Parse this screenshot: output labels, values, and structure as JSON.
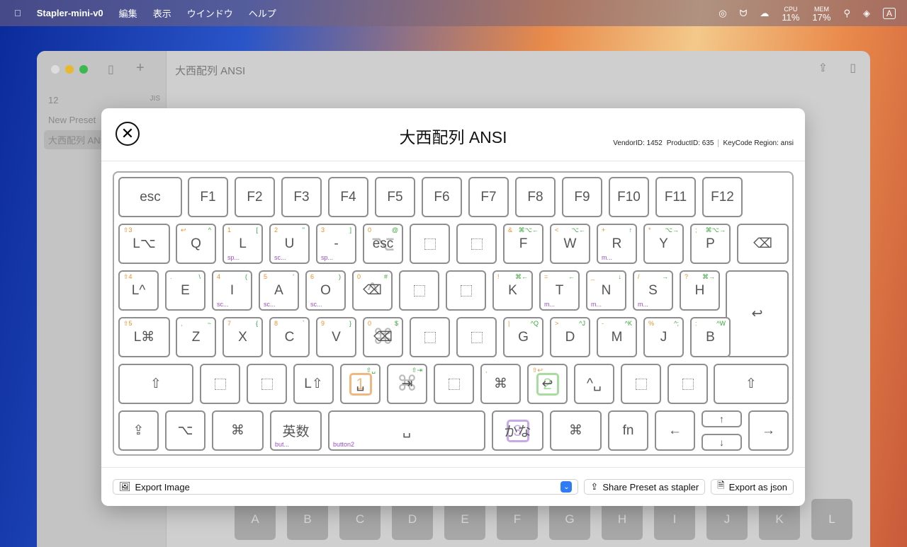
{
  "menubar": {
    "app": "Stapler-mini-v0",
    "menus": [
      "編集",
      "表示",
      "ウインドウ",
      "ヘルプ"
    ],
    "cpu_label": "CPU",
    "cpu": "11%",
    "mem_label": "MEM",
    "mem": "17%",
    "input": "A"
  },
  "window": {
    "title": "大西配列 ANSI",
    "sidebar": [
      {
        "name": "12",
        "tag": "JIS"
      },
      {
        "name": "New Preset",
        "tag": ""
      },
      {
        "name": "大西配列 ANSI",
        "tag": ""
      }
    ],
    "bg_keys": [
      "A",
      "B",
      "C",
      "D",
      "E",
      "F",
      "G",
      "H",
      "I",
      "J",
      "K",
      "L"
    ]
  },
  "modal": {
    "title": "大西配列 ANSI",
    "vendor": "VendorID: 1452",
    "product": "ProductID: 635",
    "region": "KeyCode Region: ansi",
    "export_select": "Export Image",
    "share": "Share Preset as stapler",
    "export_json": "Export as json"
  },
  "colors": {
    "tl": "#e8902a",
    "tr": "#3aa83a",
    "bl": "#9a4fc8"
  },
  "keyboard": {
    "rows": [
      [
        {
          "m": "esc"
        },
        {
          "m": "F1"
        },
        {
          "m": "F2"
        },
        {
          "m": "F3"
        },
        {
          "m": "F4"
        },
        {
          "m": "F5"
        },
        {
          "m": "F6"
        },
        {
          "m": "F7"
        },
        {
          "m": "F8"
        },
        {
          "m": "F9"
        },
        {
          "m": "F10"
        },
        {
          "m": "F11"
        },
        {
          "m": "F12"
        }
      ],
      [
        {
          "m": "L⌥",
          "tl": "⇧3"
        },
        {
          "m": "Q",
          "tl": "↩",
          "tr": "^"
        },
        {
          "m": "L",
          "tl": "1",
          "tr": "[",
          "bl": "sp..."
        },
        {
          "m": "U",
          "tl": "2",
          "tr": "\"",
          "bl": "sc..."
        },
        {
          "m": "-",
          "tl": "3",
          "tr": "]",
          "bl": "sp..."
        },
        {
          "m": "esc",
          "tl": "0",
          "tr": "@",
          "ghost": "⌥"
        },
        {
          "ph": true
        },
        {
          "ph": true
        },
        {
          "m": "F",
          "tl": "&",
          "tr": "⌘⌥←"
        },
        {
          "m": "W",
          "tl": "<",
          "tr": "⌥←"
        },
        {
          "m": "R",
          "tl": "+",
          "tr": "↑",
          "bl": "m..."
        },
        {
          "m": "Y",
          "tl": "*",
          "tr": "⌥→"
        },
        {
          "m": "P",
          "tl": ";",
          "tr": "⌘⌥→"
        },
        {
          "m": "⌫"
        }
      ],
      [
        {
          "m": "L^",
          "tl": "⇧4"
        },
        {
          "m": "E",
          "tl": ".",
          "tr": "\\"
        },
        {
          "m": "I",
          "tl": "4",
          "tr": "(",
          "bl": "sc..."
        },
        {
          "m": "A",
          "tl": "5",
          "tr": "'",
          "bl": "sc..."
        },
        {
          "m": "O",
          "tl": "6",
          "tr": ")",
          "bl": "sc..."
        },
        {
          "m": "⌫",
          "tl": "0",
          "tr": "#",
          "ghost": "^"
        },
        {
          "ph": true
        },
        {
          "ph": true
        },
        {
          "m": "K",
          "tl": "!",
          "tr": "⌘←"
        },
        {
          "m": "T",
          "tl": "=",
          "tr": "←",
          "bl": "m..."
        },
        {
          "m": "N",
          "tl": "_",
          "tr": "↓",
          "bl": "m..."
        },
        {
          "m": "S",
          "tl": "/",
          "tr": "→",
          "bl": "m..."
        },
        {
          "m": "H",
          "tl": "?",
          "tr": "⌘→"
        },
        {
          "m": "↩"
        }
      ],
      [
        {
          "m": "L⌘",
          "tl": "⇧5"
        },
        {
          "m": "Z",
          "tl": ",",
          "tr": "~"
        },
        {
          "m": "X",
          "tl": "7",
          "tr": "{"
        },
        {
          "m": "C",
          "tl": "8",
          "tr": "`"
        },
        {
          "m": "V",
          "tl": "9",
          "tr": "}"
        },
        {
          "m": "⌫",
          "tl": "0",
          "tr": "$",
          "ghost": "⌘"
        },
        {
          "ph": true
        },
        {
          "ph": true
        },
        {
          "m": "G",
          "tl": "|",
          "tr": "^Q"
        },
        {
          "m": "D",
          "tl": ">",
          "tr": "^J"
        },
        {
          "m": "M",
          "tl": "-",
          "tr": "^K"
        },
        {
          "m": "J",
          "tl": "%",
          "tr": "^;"
        },
        {
          "m": "B",
          "tl": ":",
          "tr": "^W"
        }
      ],
      [
        {
          "m": "⇧"
        },
        {
          "ph": true
        },
        {
          "ph": true
        },
        {
          "m": "L⇧"
        },
        {
          "m": "␣",
          "box": "1",
          "boxc": "#f0b880",
          "tr": "⇧␣"
        },
        {
          "m": "⇥",
          "ghost": "⌘",
          "tr": "⇧⇥"
        },
        {
          "ph": true
        },
        {
          "m": "⌘",
          "tl": ","
        },
        {
          "m": "↩",
          "box": "2",
          "boxc": "#a8dca0",
          "tl": "⇧↩"
        },
        {
          "m": "^␣"
        },
        {
          "ph": true
        },
        {
          "ph": true
        },
        {
          "m": "⇧"
        }
      ],
      [
        {
          "m": "⇪"
        },
        {
          "m": "⌥"
        },
        {
          "m": "⌘"
        },
        {
          "m": "英数",
          "bl": "but..."
        },
        {
          "m": "␣",
          "bl": "button2"
        },
        {
          "m": "かな",
          "box": "3",
          "boxc": "#c8a8e8"
        },
        {
          "m": "⌘"
        },
        {
          "m": "fn"
        },
        {
          "m": "←"
        },
        {
          "m": "↑"
        },
        {
          "m": "↓"
        },
        {
          "m": "→"
        }
      ]
    ]
  }
}
